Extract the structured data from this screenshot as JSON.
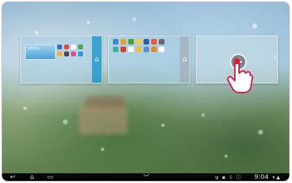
{
  "screen": {
    "name": "home-screen-edit"
  },
  "panels": {
    "p1": {
      "weather_text": "SEOUL",
      "home_glyph": "⌂"
    },
    "p2": {
      "home_glyph": "⌂"
    },
    "p3": {
      "add_glyph": "+"
    }
  },
  "navbar": {
    "back_glyph": "↩",
    "home_glyph": "⌂",
    "recent_glyph": "▭",
    "menu_glyph": "﹀",
    "clock": "9:04",
    "status_icons": [
      "usb-icon",
      "sd-card-icon",
      "download-icon",
      "info-icon",
      "wifi-icon",
      "signal-icon"
    ]
  },
  "colors": {
    "accent": "#1e96c8",
    "navbar": "#050505"
  }
}
